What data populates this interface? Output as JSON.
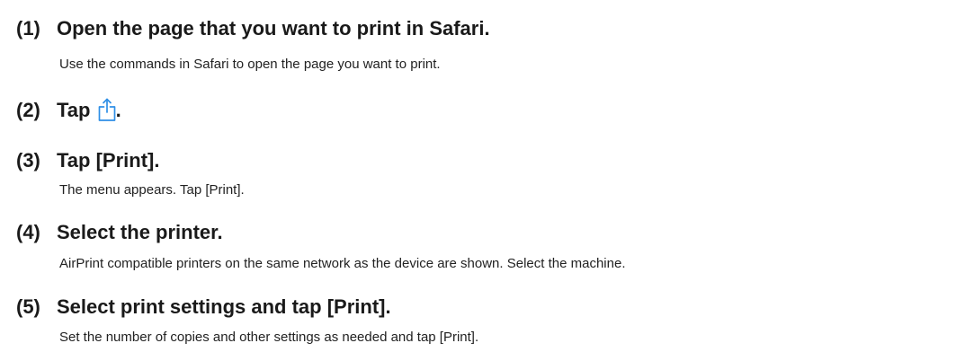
{
  "steps": [
    {
      "number": "(1)",
      "title": "Open the page that you want to print in Safari.",
      "description": "Use the commands in Safari to open the page you want to print."
    },
    {
      "number": "(2)",
      "title": "Tap",
      "title_suffix": ".",
      "icon": "share-icon",
      "description": ""
    },
    {
      "number": "(3)",
      "title": "Tap [Print].",
      "description": "The menu appears. Tap [Print]."
    },
    {
      "number": "(4)",
      "title": "Select the printer.",
      "description": "AirPrint compatible printers on the same network as the device are shown. Select the machine."
    },
    {
      "number": "(5)",
      "title": "Select print settings and tap [Print].",
      "description": "Set the number of copies and other settings as needed and tap [Print]."
    }
  ],
  "colors": {
    "text": "#1a1a1a",
    "icon": "#2f8fe6"
  }
}
